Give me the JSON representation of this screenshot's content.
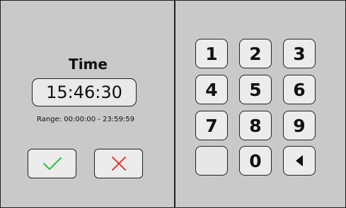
{
  "time_panel": {
    "title": "Time",
    "value": "15:46:30",
    "range": "Range: 00:00:00 - 23:59:59"
  },
  "actions": {
    "confirm_icon": "checkmark-icon",
    "cancel_icon": "x-icon",
    "confirm_color": "#2ebd49",
    "cancel_color": "#e33b3b"
  },
  "keypad": {
    "keys": [
      "1",
      "2",
      "3",
      "4",
      "5",
      "6",
      "7",
      "8",
      "9",
      "",
      "0"
    ],
    "backspace_icon": "left-triangle-icon"
  }
}
